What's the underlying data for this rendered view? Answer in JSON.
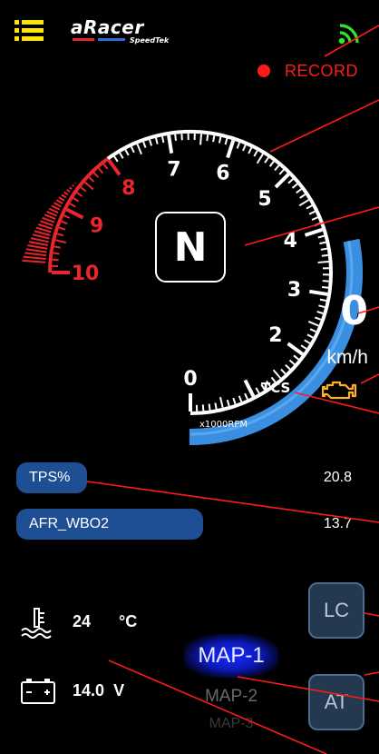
{
  "header": {
    "logo_main": "aRacer",
    "logo_sub": "SpeedTek",
    "menu_icon": "menu-icon",
    "signal_icon": "wifi-signal-icon"
  },
  "record": {
    "label": "RECORD",
    "color": "#ff1a1a"
  },
  "tachometer": {
    "unit_label": "x1000RPM",
    "ticks": [
      "0",
      "2",
      "3",
      "4",
      "5",
      "6",
      "7",
      "8",
      "9",
      "10"
    ],
    "redline_from": 8,
    "rpm_value": 0,
    "colors": {
      "white": "#ffffff",
      "red": "#e8262b",
      "blue": "#3b8fe0"
    }
  },
  "gear": {
    "value": "N"
  },
  "speed": {
    "value": "0",
    "unit": "km/h"
  },
  "indicators": {
    "tcs_label": "TCS",
    "tcs_color": "#ff9a1e",
    "engine_icon": "check-engine-icon",
    "engine_color": "#ffb21e"
  },
  "bars": [
    {
      "label": "TPS%",
      "value": "20.8",
      "fill": 0.27
    },
    {
      "label": "AFR_WBO2",
      "value": "13.7",
      "fill": 0.71
    }
  ],
  "coolant": {
    "icon": "coolant-temperature-icon",
    "value": "24",
    "unit": "°C"
  },
  "battery": {
    "icon": "battery-icon",
    "value": "14.0",
    "unit": "V"
  },
  "maps": [
    "MAP-1",
    "MAP-2",
    "MAP-3"
  ],
  "buttons": {
    "lc": "LC",
    "at": "AT"
  }
}
